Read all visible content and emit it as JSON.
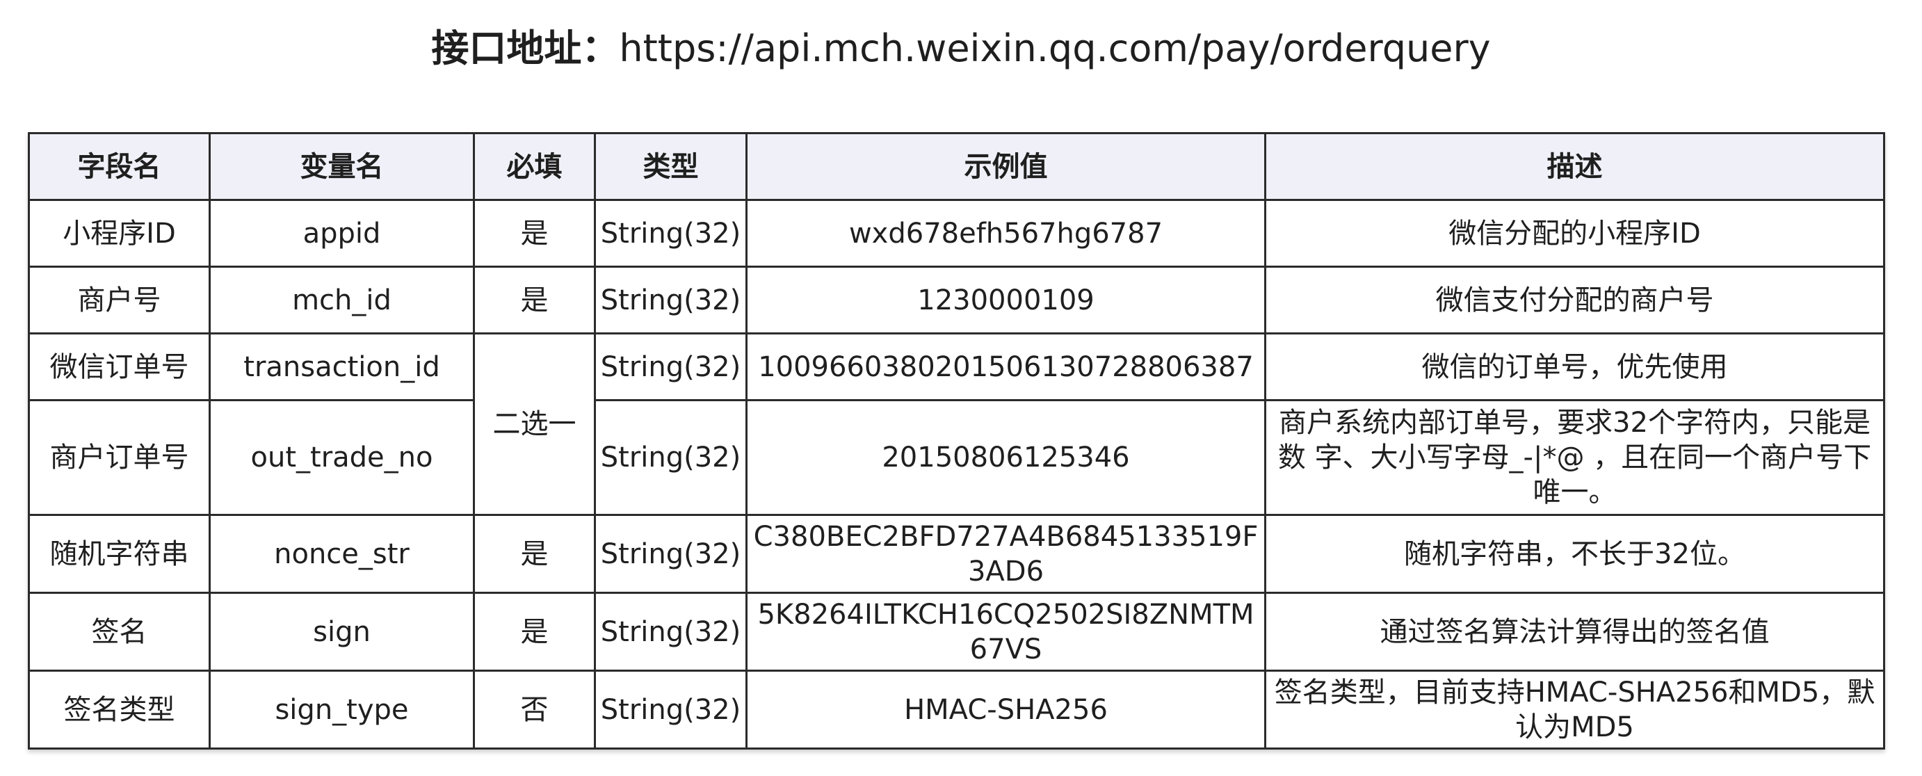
{
  "title": {
    "label": "接口地址：",
    "url": "https://api.mch.weixin.qq.com/pay/orderquery"
  },
  "table": {
    "headers": [
      "字段名",
      "变量名",
      "必填",
      "类型",
      "示例值",
      "描述"
    ],
    "rows": [
      {
        "field": "小程序ID",
        "var": "appid",
        "required": "是",
        "type": "String(32)",
        "example": "wxd678efh567hg6787",
        "desc": "微信分配的小程序ID"
      },
      {
        "field": "商户号",
        "var": "mch_id",
        "required": "是",
        "type": "String(32)",
        "example": "1230000109",
        "desc": "微信支付分配的商户号"
      },
      {
        "field": "微信订单号",
        "var": "transaction_id",
        "required": "二选一",
        "type": "String(32)",
        "example": "1009660380201506130728806387",
        "desc": "微信的订单号，优先使用"
      },
      {
        "field": "商户订单号",
        "var": "out_trade_no",
        "type": "String(32)",
        "example": "20150806125346",
        "desc": "商户系统内部订单号，要求32个字符内，只能是数 字、大小写字母_-|*@ ，且在同一个商户号下唯一。"
      },
      {
        "field": "随机字符串",
        "var": "nonce_str",
        "required": "是",
        "type": "String(32)",
        "example": "C380BEC2BFD727A4B6845133519F3AD6",
        "desc": "随机字符串，不长于32位。"
      },
      {
        "field": "签名",
        "var": "sign",
        "required": "是",
        "type": "String(32)",
        "example": "5K8264ILTKCH16CQ2502SI8ZNMTM67VS",
        "desc": "通过签名算法计算得出的签名值"
      },
      {
        "field": "签名类型",
        "var": "sign_type",
        "required": "否",
        "type": "String(32)",
        "example": "HMAC-SHA256",
        "desc": "签名类型，目前支持HMAC-SHA256和MD5，默认为MD5"
      }
    ]
  }
}
